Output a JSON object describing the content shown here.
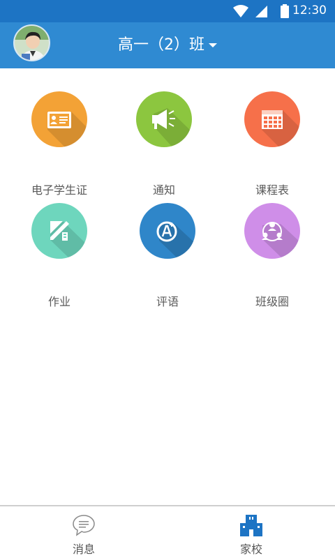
{
  "status_bar": {
    "time": "12:30"
  },
  "header": {
    "title": "高一（2）班"
  },
  "tiles": [
    {
      "label": "电子学生证",
      "color": "#f3a236",
      "icon": "id-card-icon"
    },
    {
      "label": "通知",
      "color": "#8cc63f",
      "icon": "megaphone-icon"
    },
    {
      "label": "课程表",
      "color": "#f6704a",
      "icon": "timetable-icon"
    },
    {
      "label": "作业",
      "color": "#6ed6bd",
      "icon": "pencil-ruler-icon"
    },
    {
      "label": "评语",
      "color": "#2f86c9",
      "icon": "grade-a-plus-icon"
    },
    {
      "label": "班级圈",
      "color": "#cf8ee8",
      "icon": "class-circle-icon"
    }
  ],
  "bottom_nav": [
    {
      "label": "消息",
      "icon": "chat-bubble-icon"
    },
    {
      "label": "家校",
      "icon": "school-building-icon",
      "active_color": "#1d74c4"
    }
  ]
}
